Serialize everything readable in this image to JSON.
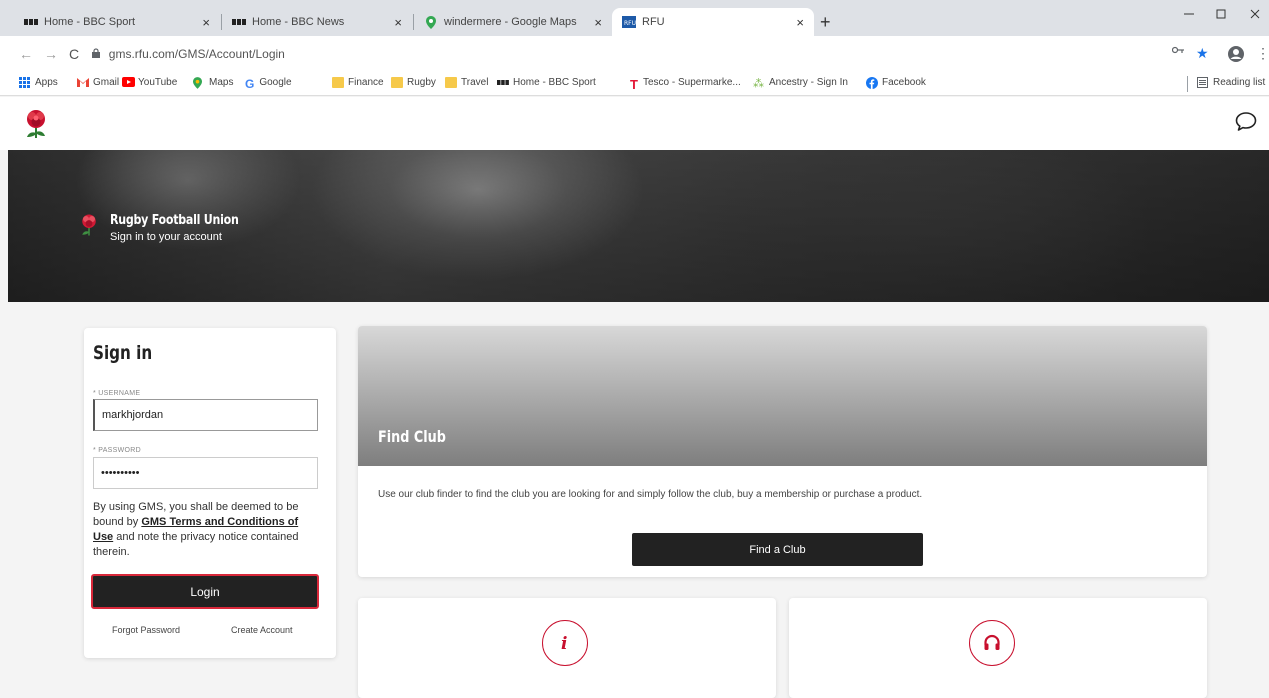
{
  "browser": {
    "tabs": [
      {
        "label": "Home - BBC Sport",
        "icon": "bbc-icon"
      },
      {
        "label": "Home - BBC News",
        "icon": "bbc-icon"
      },
      {
        "label": "windermere - Google Maps",
        "icon": "maps-pin-icon"
      },
      {
        "label": "RFU",
        "icon": "rfu-icon",
        "active": true
      }
    ],
    "close_glyph": "×",
    "new_tab_glyph": "+",
    "url": "gms.rfu.com/GMS/Account/Login",
    "bookmarks": [
      "Apps",
      "Gmail",
      "YouTube",
      "Maps",
      "Google",
      "Finance",
      "Rugby",
      "Travel",
      "Home - BBC Sport",
      "Tesco - Supermarke...",
      "Ancestry - Sign In",
      "Facebook"
    ],
    "reading_list": "Reading list"
  },
  "hero": {
    "title": "Rugby Football Union",
    "subtitle": "Sign in to your account"
  },
  "signin": {
    "heading": "Sign in",
    "username_label": "* USERNAME",
    "username_value": "markhjordan",
    "password_label": "* PASSWORD",
    "password_value": "••••••••••",
    "terms_pre": "By using GMS, you shall be deemed to be bound by ",
    "terms_link": "GMS Terms and Conditions of Use",
    "terms_post": " and note the privacy notice contained therein.",
    "login_label": "Login",
    "forgot_label": "Forgot Password",
    "create_label": "Create Account"
  },
  "find_club": {
    "title": "Find Club",
    "description": "Use our club finder to find the club you are looking for and simply follow the club, buy a membership or purchase a product.",
    "button_label": "Find a Club"
  },
  "cards": [
    {
      "icon": "info-icon"
    },
    {
      "icon": "headset-icon"
    }
  ],
  "colors": {
    "accent": "#c8102e",
    "dark_button": "#222222"
  }
}
